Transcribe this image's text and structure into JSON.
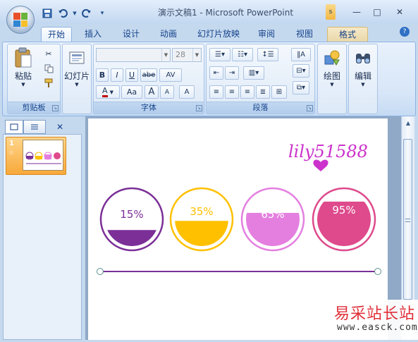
{
  "window": {
    "title": "演示文稿1 - Microsoft PowerPoint",
    "minimize": "—",
    "maximize": "□",
    "close": "✕"
  },
  "quick_access": {
    "save_icon": "save-icon",
    "undo_icon": "undo-icon",
    "redo_icon": "redo-icon",
    "customize_icon": "customize-icon"
  },
  "tabs": [
    "开始",
    "插入",
    "设计",
    "动画",
    "幻灯片放映",
    "审阅",
    "视图",
    "格式"
  ],
  "ribbon": {
    "clipboard": {
      "paste_label": "粘贴",
      "group_label": "剪贴板"
    },
    "slides": {
      "new_slide_label": "幻灯片",
      "group_label": ""
    },
    "font": {
      "font_name": "",
      "font_size": "28",
      "group_label": "字体",
      "bold": "B",
      "italic": "I",
      "underline": "U",
      "strike": "abe",
      "spacing": "AV",
      "color": "A",
      "case": "Aa",
      "grow": "A",
      "shrink": "A",
      "clear": "A"
    },
    "paragraph": {
      "group_label": "段落"
    },
    "drawing": {
      "label": "绘图"
    },
    "editing": {
      "label": "编辑"
    }
  },
  "left_panel": {
    "slide_number": "1",
    "close": "✕"
  },
  "slide": {
    "watermark": "lily51588",
    "circles": [
      {
        "label": "15%",
        "level": 0.3,
        "fill": "#7b2f97",
        "ring": "#7b2f97",
        "text": "#7b2f97"
      },
      {
        "label": "35%",
        "level": 0.47,
        "fill": "#ffc000",
        "ring": "#ffc000",
        "text": "#ffc000"
      },
      {
        "label": "65%",
        "level": 0.62,
        "fill": "#e47fe0",
        "ring": "#e47fe0",
        "text": "#ffffff"
      },
      {
        "label": "95%",
        "level": 0.83,
        "fill": "#de4a8c",
        "ring": "#de4a8c",
        "text": "#ffffff"
      }
    ],
    "line_color": "#7b2f97"
  },
  "corner_watermark": {
    "title": "易采站长站",
    "url": "www.easck.com"
  },
  "colors": {
    "accent": "#15428b",
    "ribbon_bg": "#dde9f7",
    "frame_bg": "#c5d9ee"
  }
}
